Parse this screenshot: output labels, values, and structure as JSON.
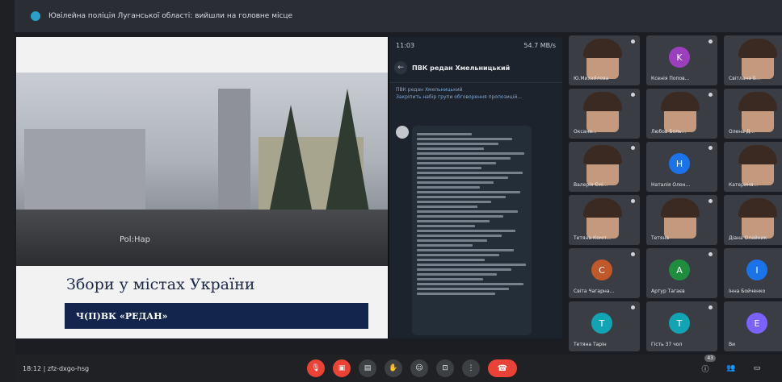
{
  "window": {
    "title": "Ювілейна поліція Луганської області: вийшли на головне місце"
  },
  "slide": {
    "watermark": "Pol:Hap",
    "title": "Збори у містах України",
    "subtitle": "Ч(П)ВК «РЕДАН»"
  },
  "phone": {
    "status_time": "11:03",
    "status_right": "54.7 MB/s",
    "chat_title": "ПВК редан Хмельницький",
    "pinned_line1": "ПВК редан Хмельницький",
    "pinned_line2": "Закріпить набір групи обговорення пропозицій..."
  },
  "participants": [
    {
      "name": "Ю.Михайлова",
      "initial": "",
      "color": "#6d7280",
      "photo": true
    },
    {
      "name": "Ксенія Попов...",
      "initial": "K",
      "color": "#9c3fbf",
      "photo": false
    },
    {
      "name": "Світлана Б...",
      "initial": "",
      "color": "#6d7280",
      "photo": true
    },
    {
      "name": "Оксана...",
      "initial": "",
      "color": "#6d7280",
      "photo": true
    },
    {
      "name": "Любов Боль...",
      "initial": "",
      "color": "#6d7280",
      "photo": true
    },
    {
      "name": "Олена Д...",
      "initial": "",
      "color": "#6d7280",
      "photo": true
    },
    {
      "name": "Валерія Ємі...",
      "initial": "",
      "color": "#6d7280",
      "photo": true
    },
    {
      "name": "Наталія Олон...",
      "initial": "H",
      "color": "#1a73e8",
      "photo": false
    },
    {
      "name": "Катерина...",
      "initial": "",
      "color": "#6d7280",
      "photo": true
    },
    {
      "name": "Тетяна Комп...",
      "initial": "",
      "color": "#6d7280",
      "photo": true
    },
    {
      "name": "Тетяна",
      "initial": "",
      "color": "#6d7280",
      "photo": true
    },
    {
      "name": "Діана Олейник",
      "initial": "",
      "color": "#6d7280",
      "photo": true
    },
    {
      "name": "Світа Чагарна...",
      "initial": "C",
      "color": "#c0582a",
      "photo": false
    },
    {
      "name": "Артур Тагаєв",
      "initial": "A",
      "color": "#1e8e3e",
      "photo": false
    },
    {
      "name": "Інна Бойченко",
      "initial": "I",
      "color": "#1a73e8",
      "photo": false
    },
    {
      "name": "Тетяна Тарін",
      "initial": "T",
      "color": "#12a4b4",
      "photo": false
    },
    {
      "name": "Гість 37 чол",
      "initial": "T",
      "color": "#12a4b4",
      "photo": false
    },
    {
      "name": "Ви",
      "initial": "E",
      "color": "#7b61ff",
      "photo": false
    }
  ],
  "bottom": {
    "meeting_info": "18:12 | zfz-dxgo-hsg",
    "participants_count": "43"
  }
}
